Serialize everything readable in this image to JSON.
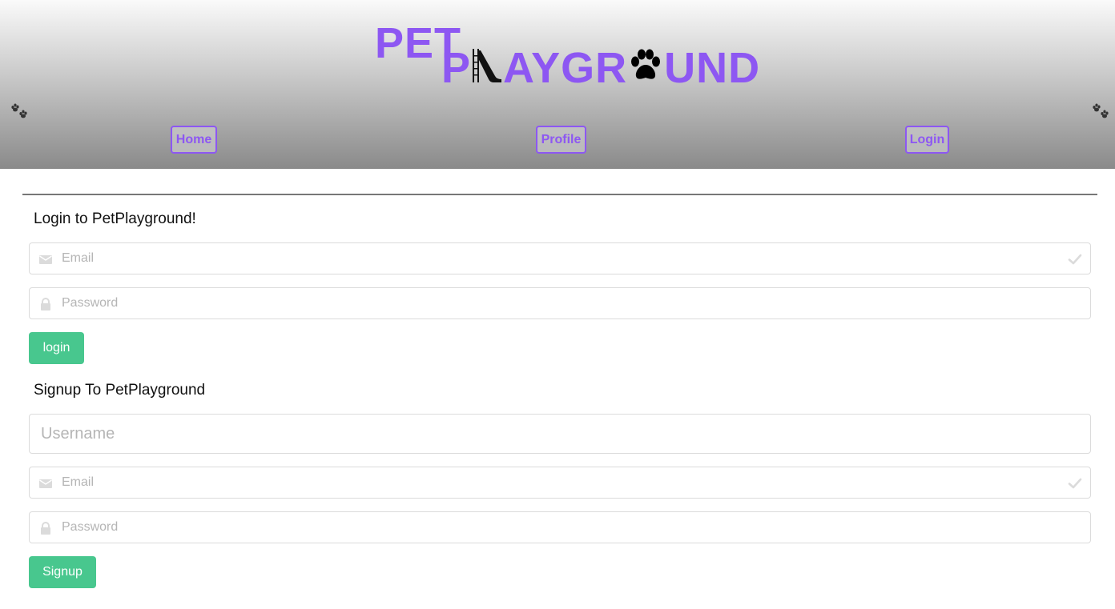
{
  "header": {
    "logo_pet": "PET",
    "logo_p": "P",
    "logo_aygr": "AYGR",
    "logo_und": "UND",
    "logo_icons": [
      "slide-icon",
      "paw-icon"
    ],
    "side_icons": [
      "paw-prints-icon",
      "paw-prints-icon"
    ],
    "accent_color": "#8d57f2"
  },
  "nav": {
    "home": "Home",
    "profile": "Profile",
    "login": "Login"
  },
  "login": {
    "title": "Login to PetPlayground!",
    "email_placeholder": "Email",
    "email_value": "",
    "password_placeholder": "Password",
    "password_value": "",
    "button": "login",
    "icons": [
      "envelope-icon",
      "check-icon",
      "lock-icon"
    ]
  },
  "signup": {
    "title": "Signup To PetPlayground",
    "username_placeholder": "Username",
    "username_value": "",
    "email_placeholder": "Email",
    "email_value": "",
    "password_placeholder": "Password",
    "password_value": "",
    "button": "Signup",
    "button_color": "#48c78e"
  }
}
